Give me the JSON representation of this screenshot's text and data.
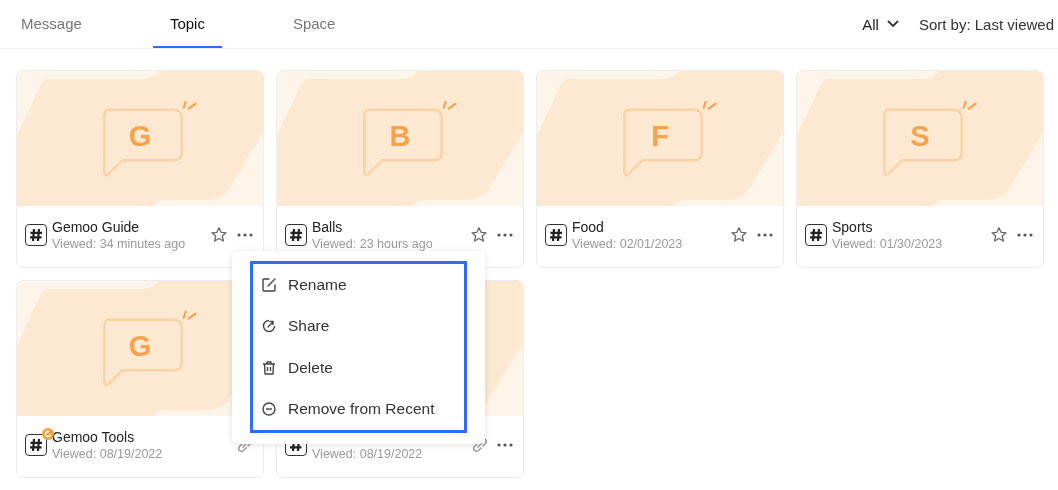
{
  "tabs": [
    {
      "label": "Message",
      "selected": false
    },
    {
      "label": "Topic",
      "selected": true
    },
    {
      "label": "Space",
      "selected": false
    }
  ],
  "filter": {
    "label": "All"
  },
  "sort": {
    "label": "Sort by: Last viewed"
  },
  "cards": [
    {
      "letter": "G",
      "title": "Gemoo Guide",
      "viewed": "Viewed: 34 minutes ago",
      "kind": "star",
      "more": true,
      "badge": false
    },
    {
      "letter": "B",
      "title": "Balls",
      "viewed": "Viewed: 23 hours ago",
      "kind": "star",
      "more": true,
      "badge": false
    },
    {
      "letter": "F",
      "title": "Food",
      "viewed": "Viewed: 02/01/2023",
      "kind": "star",
      "more": true,
      "badge": false
    },
    {
      "letter": "S",
      "title": "Sports",
      "viewed": "Viewed: 01/30/2023",
      "kind": "star",
      "more": true,
      "badge": false
    },
    {
      "letter": "G",
      "title": "Gemoo Tools",
      "viewed": "Viewed: 08/19/2022",
      "kind": "link",
      "more": false,
      "badge": true
    },
    {
      "viewed": "Viewed: 08/19/2022",
      "kind": "link",
      "more": true,
      "badge": false
    }
  ],
  "menu": {
    "items": [
      {
        "kind": "rename",
        "label": "Rename"
      },
      {
        "kind": "share",
        "label": "Share"
      },
      {
        "kind": "delete",
        "label": "Delete"
      },
      {
        "kind": "remove",
        "label": "Remove from Recent"
      }
    ],
    "highlighted": true
  }
}
